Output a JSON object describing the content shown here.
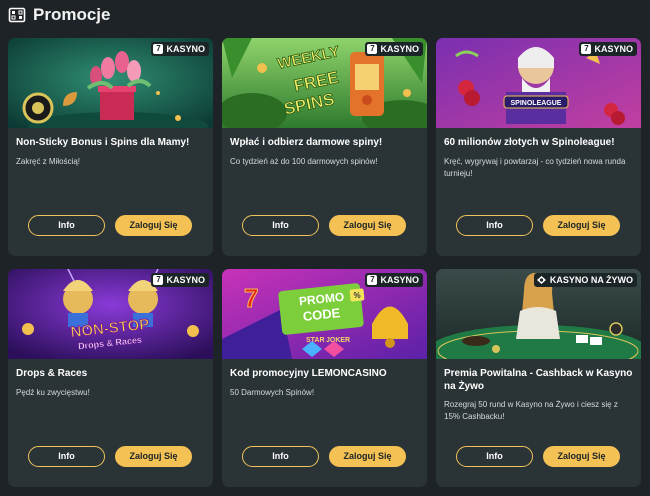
{
  "header": {
    "title": "Promocje",
    "icon": "promotions-icon"
  },
  "colors": {
    "page_bg": "#1d2326",
    "card_bg": "#2a3336",
    "accent": "#f4c155",
    "badge_bg": "#1b2426"
  },
  "cards": [
    {
      "badge": "KASYNO",
      "title": "Non-Sticky Bonus i Spins dla Mamy!",
      "description": "Zakręć z Miłością!",
      "info_label": "Info",
      "login_label": "Zaloguj Się"
    },
    {
      "badge": "KASYNO",
      "banner_text": [
        "WEEKLY",
        "FREE",
        "SPINS"
      ],
      "title": "Wpłać i odbierz darmowe spiny!",
      "description": "Co tydzień aż do 100 darmowych spinów!",
      "info_label": "Info",
      "login_label": "Zaloguj Się"
    },
    {
      "badge": "KASYNO",
      "banner_text": [
        "SPINOLEAGUE"
      ],
      "title": "60 milionów złotych w Spinoleague!",
      "description": "Kręć, wygrywaj i powtarzaj - co tydzień nowa runda turnieju!",
      "info_label": "Info",
      "login_label": "Zaloguj Się"
    },
    {
      "badge": "KASYNO",
      "banner_text": [
        "NON-STOP",
        "Drops & Races"
      ],
      "title": "Drops & Races",
      "description": "Pędź ku zwycięstwu!",
      "info_label": "Info",
      "login_label": "Zaloguj Się"
    },
    {
      "badge": "KASYNO",
      "banner_text": [
        "PROMO",
        "CODE",
        "STAR",
        "JOKER"
      ],
      "title": "Kod promocyjny LEMONCASINO",
      "description": "50 Darmowych Spinów!",
      "info_label": "Info",
      "login_label": "Zaloguj Się"
    },
    {
      "badge": "KASYNO NA ŻYWO",
      "title": "Premia Powitalna - Cashback w Kasyno na Żywo",
      "description": "Rozegraj 50 rund w Kasyno na Żywo i ciesz się z 15% Cashbacku!",
      "info_label": "Info",
      "login_label": "Zaloguj Się"
    }
  ]
}
